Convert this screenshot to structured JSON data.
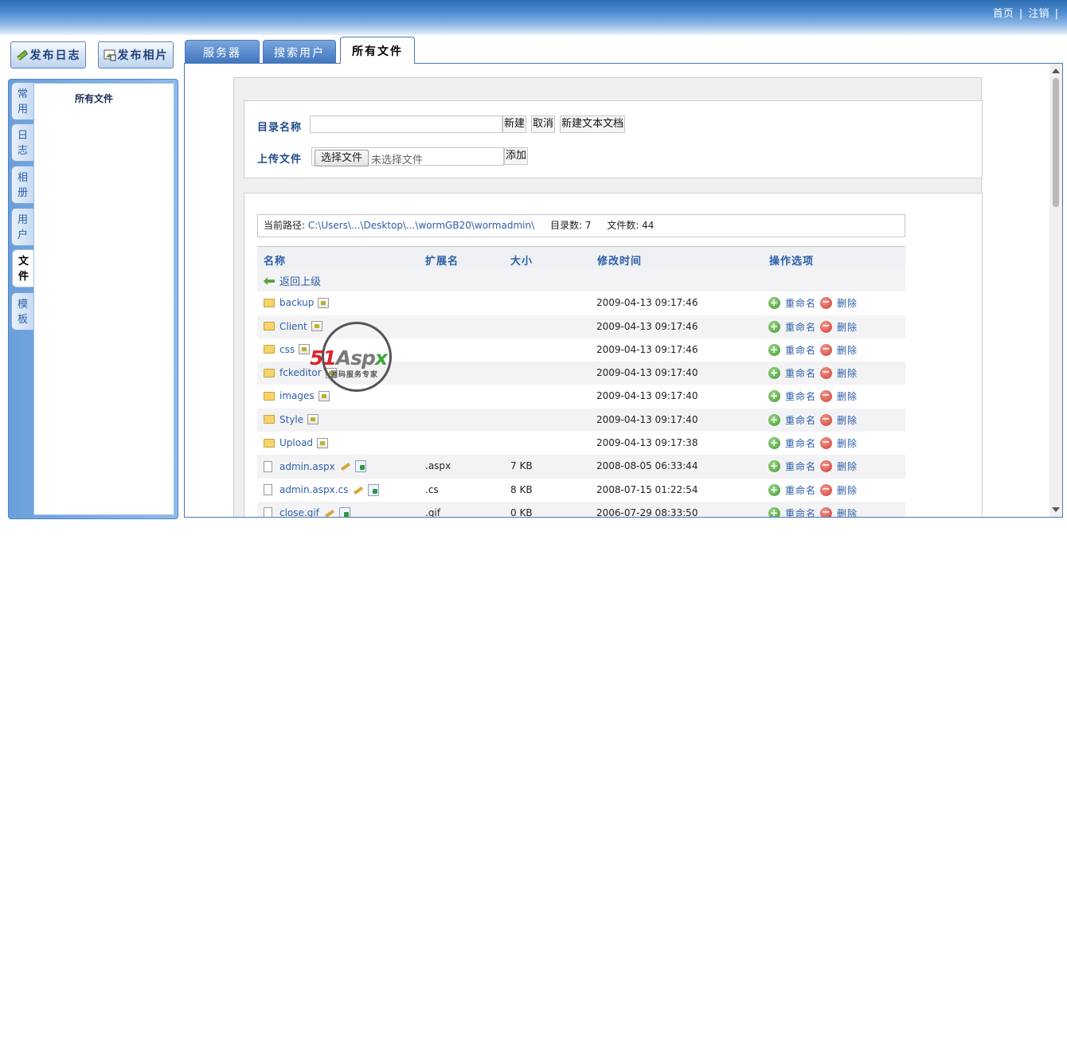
{
  "header": {
    "links": [
      "首页",
      "注销"
    ],
    "separator": "|"
  },
  "actions": {
    "post_log": "发布日志",
    "post_photo": "发布相片"
  },
  "sidebar": {
    "title": "所有文件",
    "tabs": [
      {
        "label": "常用",
        "active": false
      },
      {
        "label": "日志",
        "active": false
      },
      {
        "label": "相册",
        "active": false
      },
      {
        "label": "用户",
        "active": false
      },
      {
        "label": "文件",
        "active": true
      },
      {
        "label": "模板",
        "active": false
      }
    ]
  },
  "tabs": [
    {
      "label": "服务器",
      "active": false
    },
    {
      "label": "搜索用户",
      "active": false
    },
    {
      "label": "所有文件",
      "active": true
    }
  ],
  "form": {
    "dir_label": "目录名称",
    "dir_value": "",
    "new_btn": "新建",
    "cancel_btn": "取消",
    "new_text_btn": "新建文本文档",
    "upload_label": "上传文件",
    "choose_btn": "选择文件",
    "no_file": "未选择文件",
    "add_btn": "添加"
  },
  "path": {
    "label": "当前路径:",
    "value": "C:\\Users\\...\\Desktop\\...\\wormGB20\\wormadmin\\",
    "dir_count_label": "目录数: 7",
    "file_count_label": "文件数: 44"
  },
  "table": {
    "headers": [
      "名称",
      "扩展名",
      "大小",
      "修改时间",
      "操作选项"
    ],
    "back_label": "返回上级",
    "rename_label": "重命名",
    "delete_label": "删除",
    "rows": [
      {
        "name": "backup",
        "type": "folder",
        "ext": "",
        "size": "",
        "modified": "2009-04-13 09:17:46"
      },
      {
        "name": "Client",
        "type": "folder",
        "ext": "",
        "size": "",
        "modified": "2009-04-13 09:17:46"
      },
      {
        "name": "css",
        "type": "folder",
        "ext": "",
        "size": "",
        "modified": "2009-04-13 09:17:46"
      },
      {
        "name": "fckeditor",
        "type": "folder",
        "ext": "",
        "size": "",
        "modified": "2009-04-13 09:17:40"
      },
      {
        "name": "images",
        "type": "folder",
        "ext": "",
        "size": "",
        "modified": "2009-04-13 09:17:40"
      },
      {
        "name": "Style",
        "type": "folder",
        "ext": "",
        "size": "",
        "modified": "2009-04-13 09:17:40"
      },
      {
        "name": "Upload",
        "type": "folder",
        "ext": "",
        "size": "",
        "modified": "2009-04-13 09:17:38"
      },
      {
        "name": "admin.aspx",
        "type": "file",
        "ext": ".aspx",
        "size": "7 KB",
        "modified": "2008-08-05 06:33:44"
      },
      {
        "name": "admin.aspx.cs",
        "type": "file",
        "ext": ".cs",
        "size": "8 KB",
        "modified": "2008-07-15 01:22:54"
      },
      {
        "name": "close.gif",
        "type": "file",
        "ext": ".gif",
        "size": "0 KB",
        "modified": "2006-07-29 08:33:50"
      }
    ]
  },
  "watermark": {
    "brand_a": "51",
    "brand_b": "Asp",
    "brand_c": "x",
    "tagline": "源码服务专家"
  }
}
